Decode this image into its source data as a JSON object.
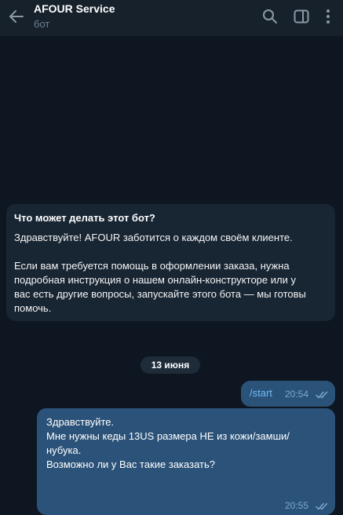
{
  "header": {
    "title": "AFOUR Service",
    "subtitle": "бот",
    "icons": [
      "back-arrow-icon",
      "search-icon",
      "sidebar-panel-icon",
      "more-vert-icon"
    ]
  },
  "bot_info": {
    "title": "Что может делать этот бот?",
    "greeting": "Здравствуйте! AFOUR заботится о каждом своём клиенте.",
    "description_lines": [
      "Если вам требуется помощь в оформлении заказа, нужна",
      "подробная инструкция о нашем онлайн-конструкторе или у",
      "вас есть другие вопросы, запускайте этого бота — мы готовы",
      "помочь."
    ]
  },
  "date_separator": "13 июня",
  "messages": [
    {
      "text": "/start",
      "time": "20:54",
      "status": "read"
    },
    {
      "lines": [
        "Здравствуйте.",
        "Мне нужны кеды 13US размера НЕ из кожи/замши/",
        "нубука.",
        "Возможно ли у Вас такие заказать?"
      ],
      "time": "20:55",
      "status": "read"
    }
  ],
  "colors": {
    "chat_background": "#0e1621",
    "header_background": "#17212b",
    "incoming_card": "#182533",
    "outgoing_bubble": "#2b5278",
    "command_link": "#71baf8",
    "meta_text": "#7da8d3"
  }
}
